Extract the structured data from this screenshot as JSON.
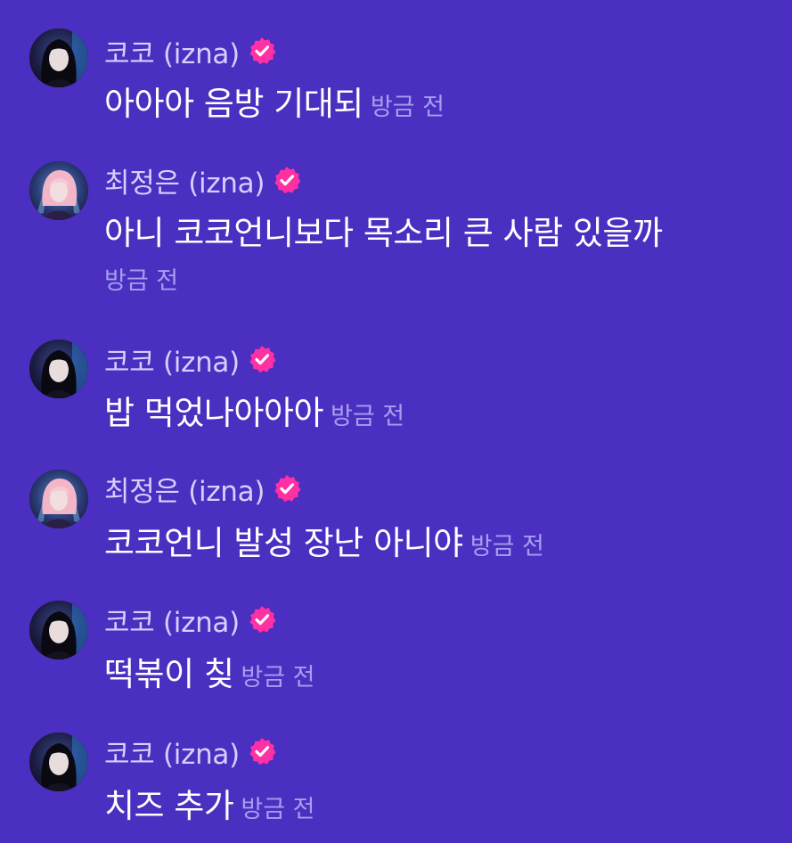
{
  "colors": {
    "background": "#4a2fc0",
    "sender_name": "#d6d0ff",
    "message_text": "#ffffff",
    "timestamp": "#a79ef0",
    "verified_badge": "#ff2fa4"
  },
  "messages": [
    {
      "sender": "코코 (izna)",
      "avatar": "avatar-koko",
      "text": "아아아 음방 기대되",
      "time": "방금 전",
      "verified": true
    },
    {
      "sender": "최정은 (izna)",
      "avatar": "avatar-jungeun",
      "text": "아니 코코언니보다 목소리 큰 사람 있을까",
      "time": "방금 전",
      "verified": true
    },
    {
      "sender": "코코 (izna)",
      "avatar": "avatar-koko",
      "text": "밥 먹었나아아아",
      "time": "방금 전",
      "verified": true
    },
    {
      "sender": "최정은 (izna)",
      "avatar": "avatar-jungeun",
      "text": "코코언니 발성 장난 아니야",
      "time": "방금 전",
      "verified": true
    },
    {
      "sender": "코코 (izna)",
      "avatar": "avatar-koko",
      "text": "떡볶이 칮",
      "time": "방금 전",
      "verified": true
    },
    {
      "sender": "코코 (izna)",
      "avatar": "avatar-koko",
      "text": "치즈 추가",
      "time": "방금 전",
      "verified": true
    }
  ]
}
